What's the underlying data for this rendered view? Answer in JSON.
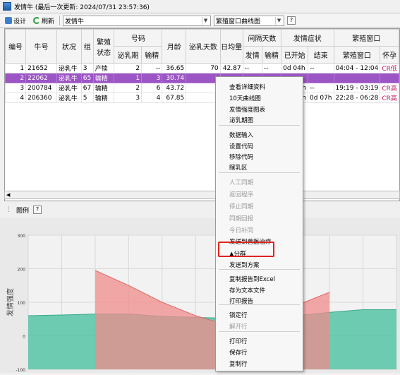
{
  "window": {
    "title": "发情牛 (最后一次更新: 2024/07/31 23:57:36)"
  },
  "toolbar": {
    "design_label": "设计",
    "refresh_label": "刷新",
    "category_value": "发情牛",
    "view_value": "繁殖窗口曲线图",
    "help_label": "?"
  },
  "grid": {
    "headers": {
      "index": "编号",
      "cow_no": "牛号",
      "status": "状况",
      "group": "组",
      "breed_status": "繁殖状态",
      "code_group": "号码",
      "lactation_no": "泌乳期",
      "insem_no": "输精",
      "age_month": "月龄",
      "milk_days": "泌乳天数",
      "daily_avg": "日均量",
      "interval_group": "间隔天数",
      "interval_heat": "发情",
      "interval_insem": "输精",
      "heat_group": "发情症状",
      "heat_started": "已开始",
      "heat_end": "结束",
      "window_group": "繁殖窗口",
      "window_col": "繁殖窗口",
      "pregnant": "怀孕"
    },
    "rows": [
      {
        "idx": "1",
        "cow": "21652",
        "status": "泌乳牛",
        "group": "3",
        "breed": "产犊",
        "lact": "2",
        "insem": "--",
        "age": "36.65",
        "days": "70",
        "avg": "42.87",
        "iheat": "--",
        "iinsem": "--",
        "started": "0d 04h",
        "end": "--",
        "window": "04:04 - 12:04",
        "preg": "CR低"
      },
      {
        "idx": "2",
        "cow": "22062",
        "status": "泌乳牛",
        "group": "65",
        "breed": "输精",
        "lact": "1",
        "insem": "3",
        "age": "30.74",
        "days": "",
        "avg": "",
        "iheat": "",
        "iinsem": "",
        "started": "",
        "end": "",
        "window": "",
        "preg": ""
      },
      {
        "idx": "3",
        "cow": "200784",
        "status": "泌乳牛",
        "group": "67",
        "breed": "输精",
        "lact": "2",
        "insem": "6",
        "age": "43.72",
        "days": "",
        "avg": "",
        "iheat": "",
        "iinsem": "",
        "started": "3h",
        "end": "--",
        "window": "19:19 - 03:19",
        "preg": "CR高"
      },
      {
        "idx": "4",
        "cow": "206360",
        "status": "泌乳牛",
        "group": "5",
        "breed": "输精",
        "lact": "3",
        "insem": "4",
        "age": "67.85",
        "days": "",
        "avg": "",
        "iheat": "",
        "iinsem": "",
        "started": "8h",
        "end": "0d 07h",
        "window": "22:28 - 06:28",
        "preg": "CR高"
      }
    ]
  },
  "legend": {
    "label": "图例",
    "help": "?"
  },
  "chart_data": {
    "type": "area",
    "ylabel": "发情强度",
    "ylim": [
      -100,
      300
    ],
    "yticks": [
      "300",
      "200",
      "100",
      "0",
      "-100"
    ],
    "series": [
      {
        "values": [
          60,
          62,
          65,
          65,
          58,
          55,
          52,
          50,
          60,
          70,
          78,
          78
        ],
        "color": "#56c4a6"
      },
      {
        "values": [
          null,
          null,
          195,
          150,
          100,
          60,
          30,
          60,
          90,
          130,
          null,
          null
        ],
        "color": "#f08c8c"
      }
    ],
    "x": [
      0,
      1,
      2,
      3,
      4,
      5,
      6,
      7,
      8,
      9,
      10,
      11
    ]
  },
  "context_menu": {
    "items": [
      {
        "label": "查看详细资料",
        "enabled": true
      },
      {
        "label": "10天曲线图",
        "enabled": true
      },
      {
        "label": "发情强度图表",
        "enabled": true
      },
      {
        "label": "泌乳期图",
        "enabled": true
      },
      {
        "label": "数据输入",
        "enabled": true
      },
      {
        "label": "设置代码",
        "enabled": true
      },
      {
        "label": "移除代码",
        "enabled": true
      },
      {
        "label": "瞎乳区",
        "enabled": true
      },
      {
        "label": "人工同期",
        "enabled": false
      },
      {
        "label": "返回程序",
        "enabled": false
      },
      {
        "label": "停止同期",
        "enabled": false
      },
      {
        "label": "同期回报",
        "enabled": false
      },
      {
        "label": "今日补同",
        "enabled": false
      },
      {
        "label": "发送到兽医治疗",
        "enabled": true
      },
      {
        "label": "▲分群",
        "enabled": true
      },
      {
        "label": "发送到方案",
        "enabled": true
      },
      {
        "label": "复制报告到Excel",
        "enabled": true
      },
      {
        "label": "存为文本文件",
        "enabled": true
      },
      {
        "label": "打印报告",
        "enabled": true
      },
      {
        "label": "锁定行",
        "enabled": true
      },
      {
        "label": "解开行",
        "enabled": false
      },
      {
        "label": "打印行",
        "enabled": true
      },
      {
        "label": "保存行",
        "enabled": true
      },
      {
        "label": "复制行",
        "enabled": true
      }
    ]
  }
}
